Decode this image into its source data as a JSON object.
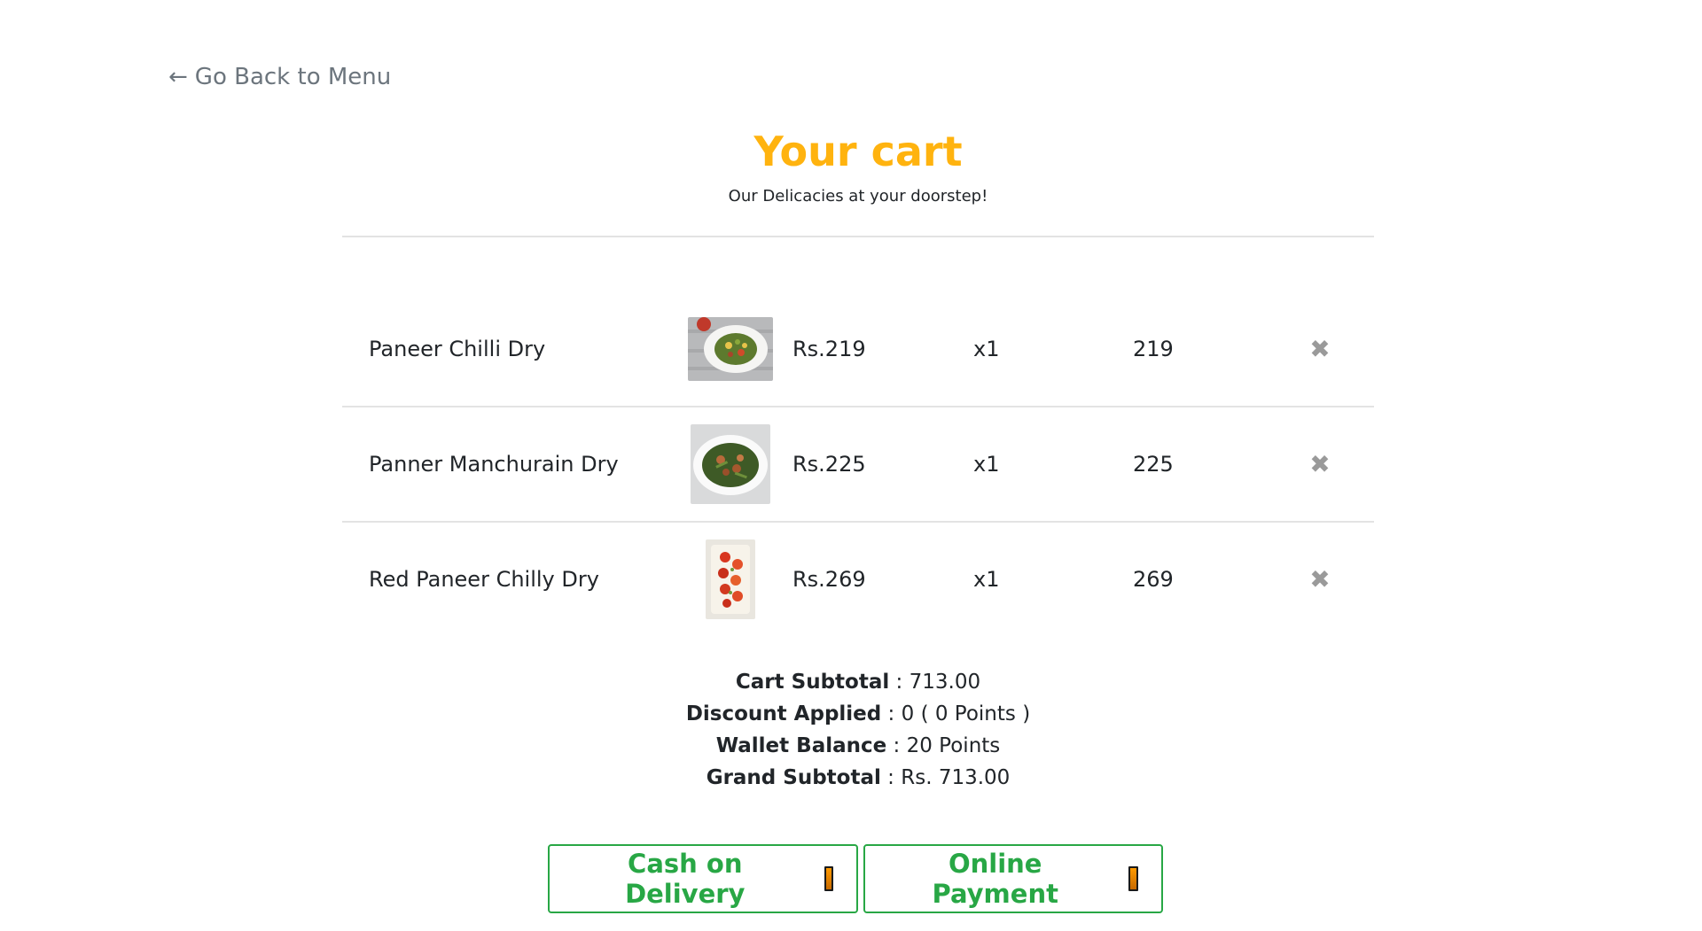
{
  "nav": {
    "back_arrow": "←",
    "back_label": "Go Back to Menu"
  },
  "header": {
    "title": "Your cart",
    "subtitle": "Our Delicacies at your doorstep!"
  },
  "cart": {
    "items": [
      {
        "name": "Paneer Chilli Dry",
        "price": "Rs.219",
        "qty": "x1",
        "total": "219",
        "remove": "✖"
      },
      {
        "name": "Panner Manchurain Dry",
        "price": "Rs.225",
        "qty": "x1",
        "total": "225",
        "remove": "✖"
      },
      {
        "name": "Red Paneer Chilly Dry",
        "price": "Rs.269",
        "qty": "x1",
        "total": "269",
        "remove": "✖"
      }
    ]
  },
  "summary": {
    "subtotal_label": "Cart Subtotal",
    "subtotal_value": " : 713.00",
    "discount_label": "Discount Applied",
    "discount_value": " : 0 ( 0 Points )",
    "wallet_label": "Wallet Balance",
    "wallet_value": " : 20 Points",
    "grand_label": "Grand Subtotal",
    "grand_value": " : Rs. 713.00"
  },
  "payment": {
    "cod_label": "Cash on Delivery",
    "online_label": "Online Payment"
  },
  "colors": {
    "accent": "#ffb30f",
    "button_green": "#28a745"
  }
}
